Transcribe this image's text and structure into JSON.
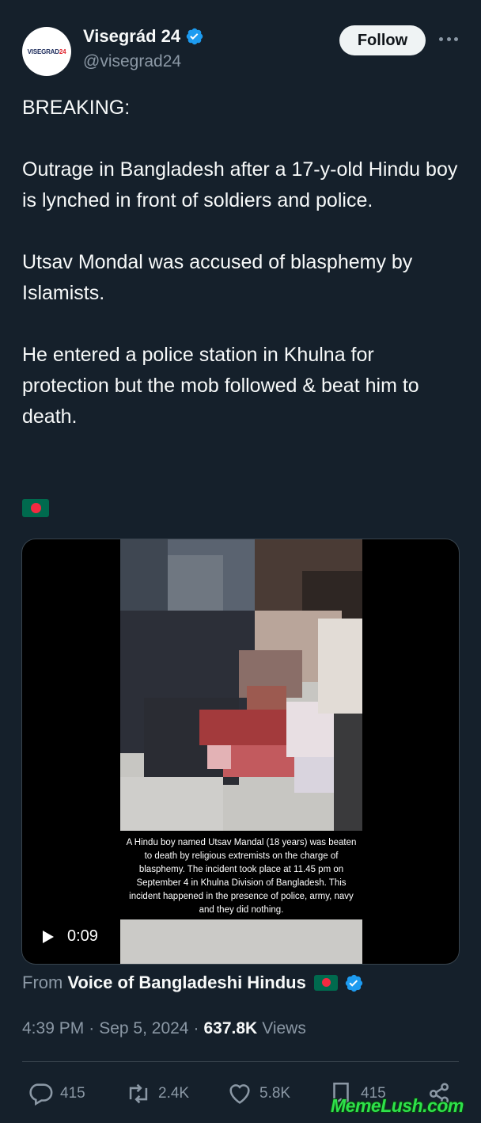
{
  "account": {
    "display_name": "Visegrád 24",
    "handle": "@visegrad24",
    "avatar_text_main": "VISEGRAD",
    "avatar_text_num": "24",
    "verified": true
  },
  "header": {
    "follow_label": "Follow",
    "more_icon": "more-horizontal-icon"
  },
  "tweet": {
    "line_breaking": "BREAKING:",
    "para_1": "Outrage in Bangladesh after a 17-y-old Hindu boy is lynched in front of soldiers and police.",
    "para_2": "Utsav Mondal was accused of blasphemy by Islamists.",
    "para_3": "He entered a police station in Khulna for protection but the mob followed & beat him to death.",
    "flag_emoji": "bangladesh-flag"
  },
  "media": {
    "type": "video",
    "caption": "A Hindu boy named Utsav Mandal (18 years) was beaten to death by religious extremists on the charge of blasphemy. The incident took place at 11.45 pm on September 4 in Khulna Division of Bangladesh. This incident happened in the presence of police, army, navy and they did nothing.",
    "duration": "0:09",
    "play_icon": "play-icon"
  },
  "source": {
    "from_label": "From",
    "name": "Voice of Bangladeshi Hindus",
    "flag_emoji": "bangladesh-flag",
    "verified": true
  },
  "meta": {
    "time": "4:39 PM",
    "separator": "·",
    "date": "Sep 5, 2024",
    "views_count": "637.8K",
    "views_label": "Views"
  },
  "actions": {
    "replies": "415",
    "reposts": "2.4K",
    "likes": "5.8K",
    "bookmarks": "415"
  },
  "watermark": "MemeLush.com",
  "colors": {
    "background": "#15202b",
    "text_primary": "#f7f9f9",
    "text_secondary": "#8b98a5",
    "verified_blue": "#1d9bf0",
    "border": "#38444d",
    "follow_bg": "#eff3f4"
  }
}
